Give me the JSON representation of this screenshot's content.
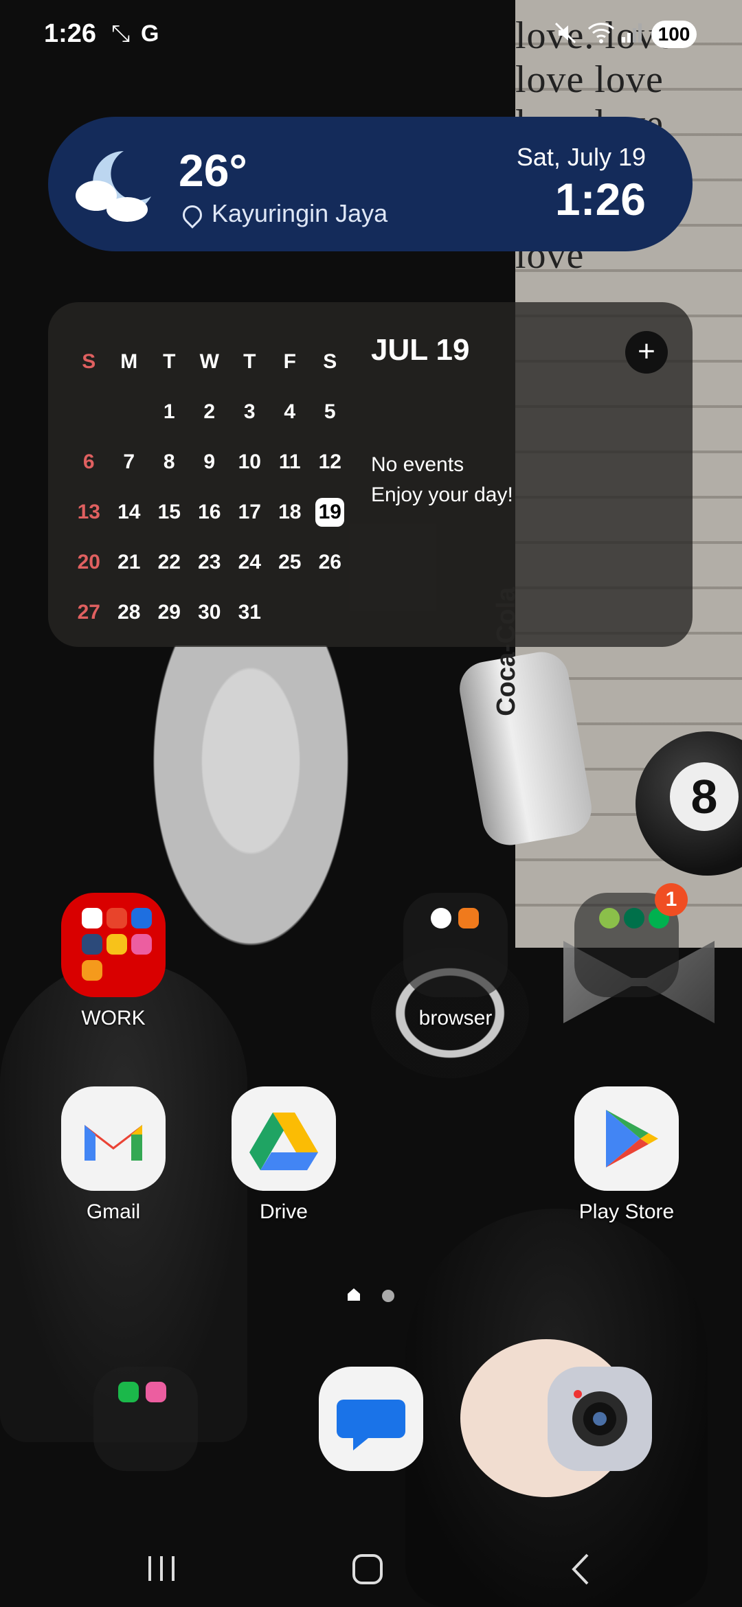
{
  "status_bar": {
    "time": "1:26",
    "battery": "100"
  },
  "weather": {
    "temperature": "26°",
    "location": "Kayuringin Jaya",
    "date": "Sat, July 19",
    "time": "1:26"
  },
  "calendar": {
    "weekdays": [
      "S",
      "M",
      "T",
      "W",
      "T",
      "F",
      "S"
    ],
    "weeks": [
      [
        "",
        "",
        "1",
        "2",
        "3",
        "4",
        "5"
      ],
      [
        "6",
        "7",
        "8",
        "9",
        "10",
        "11",
        "12"
      ],
      [
        "13",
        "14",
        "15",
        "16",
        "17",
        "18",
        "19"
      ],
      [
        "20",
        "21",
        "22",
        "23",
        "24",
        "25",
        "26"
      ],
      [
        "27",
        "28",
        "29",
        "30",
        "31",
        "",
        ""
      ]
    ],
    "today": "19",
    "selected_date": "JUL 19",
    "add_label": "+",
    "no_events": "No events",
    "enjoy": "Enjoy your day!"
  },
  "home": {
    "folders": [
      {
        "label": "WORK"
      },
      {
        "label": "browser"
      },
      {
        "label": "",
        "badge": "1"
      }
    ],
    "apps": [
      {
        "label": "Gmail"
      },
      {
        "label": "Drive"
      },
      {
        "label": "Play Store"
      }
    ]
  },
  "dock": {
    "items": [
      "phone-folder",
      "messages",
      "camera"
    ]
  },
  "colors": {
    "weather_bg": "#142b5a",
    "calendar_bg": "#2a2826",
    "sunday_red": "#e06060",
    "badge_orange": "#f04e23",
    "work_folder_red": "#d90000"
  }
}
